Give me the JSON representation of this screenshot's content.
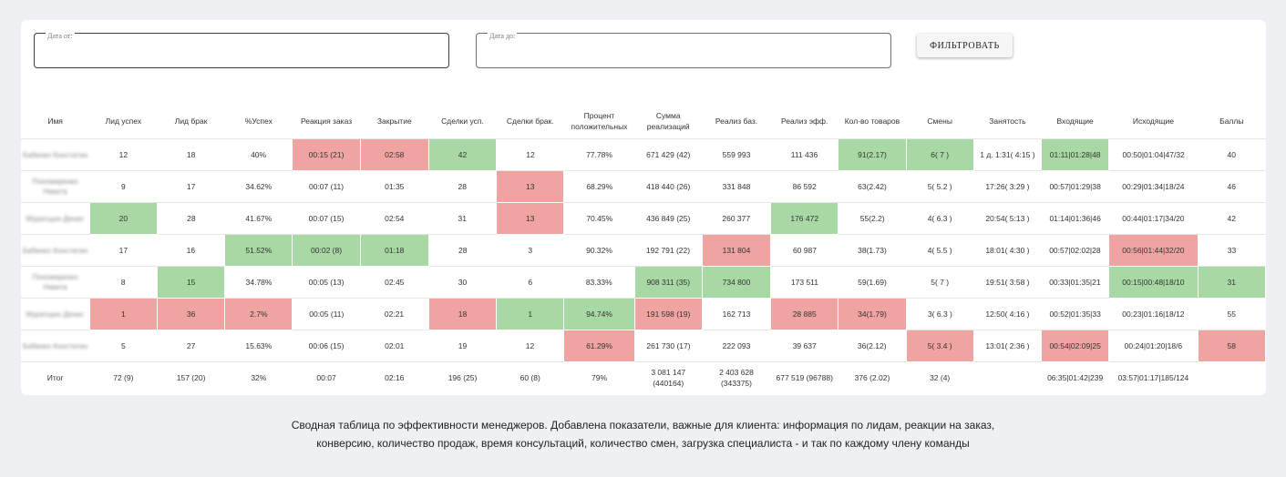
{
  "filters": {
    "date_from_label": "Дата от:",
    "date_to_label": "Дата до:",
    "filter_button": "ФИЛЬТРОВАТЬ"
  },
  "table": {
    "columns": [
      "Имя",
      "Лид успех",
      "Лид брак",
      "%Успех",
      "Реакция заказ",
      "Закрытие",
      "Сделки усп.",
      "Сделки брак.",
      "Процент положительных",
      "Сумма реализаций",
      "Реализ баз.",
      "Реализ эфф.",
      "Кол-во товаров",
      "Смены",
      "Занятость",
      "Входящие",
      "Исходящие",
      "Баллы"
    ],
    "rows": [
      {
        "name": "Бабенко Констатин",
        "cells": [
          "12",
          "18",
          "40%",
          "00:15 (21)",
          "02:58",
          "42",
          "12",
          "77.78%",
          "671 429 (42)",
          "559 993",
          "111 436",
          "91(2.17)",
          "6( 7 )",
          "1 д. 1:31( 4:15 )",
          "01:11|01:28|48",
          "00:50|01:04|47/32",
          "40"
        ],
        "status": [
          "",
          "",
          "",
          "bad",
          "bad",
          "good",
          "",
          "",
          "",
          "",
          "",
          "good",
          "good",
          "",
          "good",
          "",
          ""
        ]
      },
      {
        "name": "Пономаренко Никита",
        "cells": [
          "9",
          "17",
          "34.62%",
          "00:07 (11)",
          "01:35",
          "28",
          "13",
          "68.29%",
          "418 440 (26)",
          "331 848",
          "86 592",
          "63(2.42)",
          "5( 5.2 )",
          "17:26( 3:29 )",
          "00:57|01:29|38",
          "00:29|01:34|18/24",
          "46"
        ],
        "status": [
          "",
          "",
          "",
          "",
          "",
          "",
          "bad",
          "",
          "",
          "",
          "",
          "",
          "",
          "",
          "",
          "",
          ""
        ]
      },
      {
        "name": "Муратщин Денис",
        "cells": [
          "20",
          "28",
          "41.67%",
          "00:07 (15)",
          "02:54",
          "31",
          "13",
          "70.45%",
          "436 849 (25)",
          "260 377",
          "176 472",
          "55(2.2)",
          "4( 6.3 )",
          "20:54( 5:13 )",
          "01:14|01:36|46",
          "00:44|01:17|34/20",
          "42"
        ],
        "status": [
          "good",
          "",
          "",
          "",
          "",
          "",
          "bad",
          "",
          "",
          "",
          "good",
          "",
          "",
          "",
          "",
          "",
          ""
        ]
      },
      {
        "name": "Бабенко Констатин",
        "cells": [
          "17",
          "16",
          "51.52%",
          "00:02 (8)",
          "01:18",
          "28",
          "3",
          "90.32%",
          "192 791 (22)",
          "131 804",
          "60 987",
          "38(1.73)",
          "4( 5.5 )",
          "18:01( 4:30 )",
          "00:57|02:02|28",
          "00:56|01:44|32/20",
          "33"
        ],
        "status": [
          "",
          "",
          "good",
          "good",
          "good",
          "",
          "",
          "",
          "",
          "bad",
          "",
          "",
          "",
          "",
          "",
          "bad",
          ""
        ]
      },
      {
        "name": "Пономаренко Никита",
        "cells": [
          "8",
          "15",
          "34.78%",
          "00:05 (13)",
          "02:45",
          "30",
          "6",
          "83.33%",
          "908 311 (35)",
          "734 800",
          "173 511",
          "59(1.69)",
          "5( 7 )",
          "19:51( 3:58 )",
          "00:33|01:35|21",
          "00:15|00:48|18/10",
          "31"
        ],
        "status": [
          "",
          "good",
          "",
          "",
          "",
          "",
          "",
          "",
          "good",
          "good",
          "",
          "",
          "",
          "",
          "",
          "good",
          "good"
        ]
      },
      {
        "name": "Муратщин Денис",
        "cells": [
          "1",
          "36",
          "2.7%",
          "00:05 (11)",
          "02:21",
          "18",
          "1",
          "94.74%",
          "191 598 (19)",
          "162 713",
          "28 885",
          "34(1.79)",
          "3( 6.3 )",
          "12:50( 4:16 )",
          "00:52|01:35|33",
          "00:23|01:16|18/12",
          "55"
        ],
        "status": [
          "bad",
          "bad",
          "bad",
          "",
          "",
          "bad",
          "good",
          "good",
          "bad",
          "",
          "bad",
          "bad",
          "",
          "",
          "",
          "",
          ""
        ]
      },
      {
        "name": "Бабенко Констатин",
        "cells": [
          "5",
          "27",
          "15.63%",
          "00:06 (15)",
          "02:01",
          "19",
          "12",
          "61.29%",
          "261 730 (17)",
          "222 093",
          "39 637",
          "36(2.12)",
          "5( 3.4 )",
          "13:01( 2:36 )",
          "00:54|02:09|25",
          "00:24|01:20|18/6",
          "58"
        ],
        "status": [
          "",
          "",
          "",
          "",
          "",
          "",
          "",
          "bad",
          "",
          "",
          "",
          "",
          "bad",
          "",
          "bad",
          "",
          "bad"
        ]
      }
    ],
    "total": {
      "name": "Итог",
      "cells": [
        "72 (9)",
        "157 (20)",
        "32%",
        "00:07",
        "02:16",
        "196 (25)",
        "60 (8)",
        "79%",
        "3 081 147 (440164)",
        "2 403 628 (343375)",
        "677 519 (96788)",
        "376 (2.02)",
        "32 (4)",
        "",
        "06:35|01:42|239",
        "03:57|01:17|185/124",
        ""
      ]
    }
  },
  "caption": {
    "line1": "Сводная таблица по эффективности менеджеров. Добавлена показатели, важные для клиента: информация по лидам, реакции на заказ,",
    "line2": "конверсию, количество продаж, время консультаций, количество смен, загрузка специалиста - и так по каждому члену команды"
  }
}
